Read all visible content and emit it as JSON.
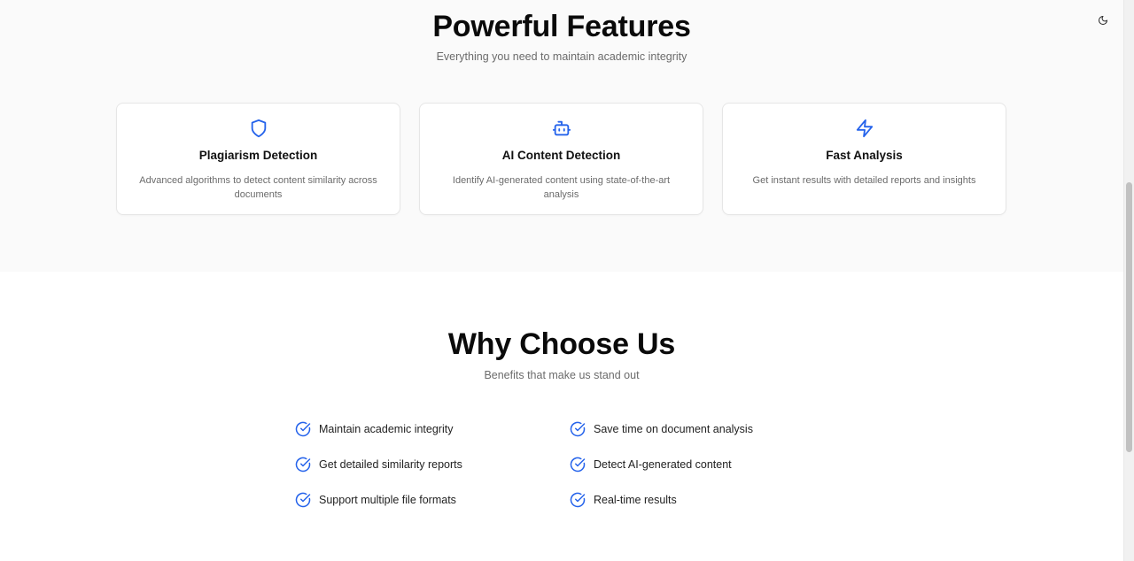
{
  "features": {
    "title": "Powerful Features",
    "subtitle": "Everything you need to maintain academic integrity",
    "cards": [
      {
        "icon": "shield-icon",
        "title": "Plagiarism Detection",
        "description": "Advanced algorithms to detect content similarity across documents"
      },
      {
        "icon": "robot-icon",
        "title": "AI Content Detection",
        "description": "Identify AI-generated content using state-of-the-art analysis"
      },
      {
        "icon": "lightning-icon",
        "title": "Fast Analysis",
        "description": "Get instant results with detailed reports and insights"
      }
    ]
  },
  "why": {
    "title": "Why Choose Us",
    "subtitle": "Benefits that make us stand out",
    "benefits": [
      "Maintain academic integrity",
      "Save time on document analysis",
      "Get detailed similarity reports",
      "Detect AI-generated content",
      "Support multiple file formats",
      "Real-time results"
    ]
  },
  "header": {
    "theme_toggle_icon": "moon-icon"
  },
  "colors": {
    "accent": "#2563eb",
    "section_bg": "#fafafa",
    "muted_text": "#6b6b6b"
  }
}
